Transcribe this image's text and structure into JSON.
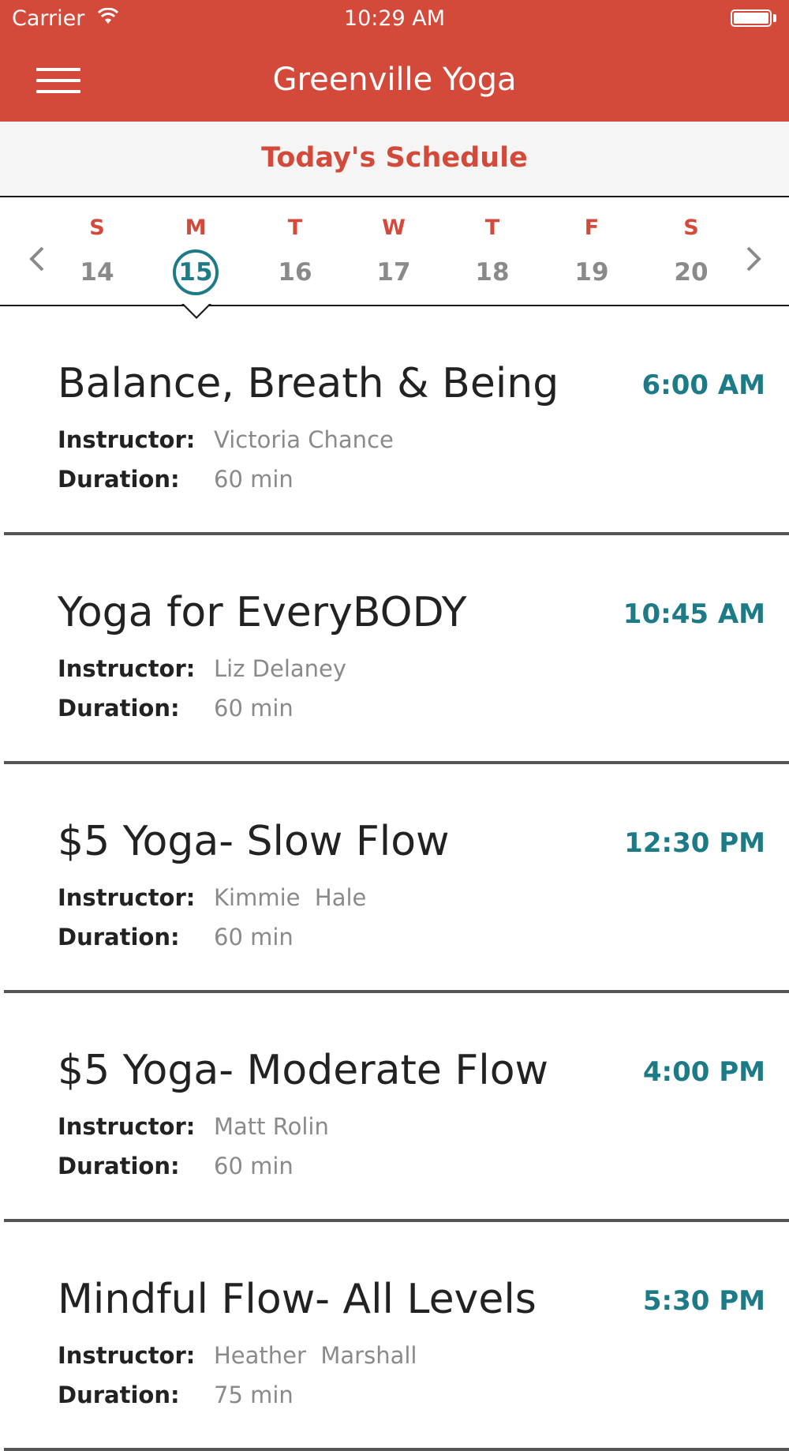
{
  "status_bar": {
    "carrier": "Carrier",
    "time": "10:29 AM"
  },
  "nav": {
    "title": "Greenville Yoga",
    "menu_icon": "hamburger-menu-icon"
  },
  "schedule_header": {
    "title": "Today's Schedule"
  },
  "week": {
    "days": [
      {
        "letter": "S",
        "number": "14"
      },
      {
        "letter": "M",
        "number": "15",
        "selected": true
      },
      {
        "letter": "T",
        "number": "16"
      },
      {
        "letter": "W",
        "number": "17"
      },
      {
        "letter": "T",
        "number": "18"
      },
      {
        "letter": "F",
        "number": "19"
      },
      {
        "letter": "S",
        "number": "20"
      }
    ]
  },
  "labels": {
    "instructor": "Instructor:",
    "duration": "Duration:"
  },
  "classes": [
    {
      "title": "Balance, Breath & Being",
      "time": "6:00 AM",
      "instructor": "Victoria Chance",
      "duration": "60 min"
    },
    {
      "title": "Yoga for EveryBODY",
      "time": "10:45 AM",
      "instructor": "Liz Delaney",
      "duration": "60 min"
    },
    {
      "title": "$5 Yoga- Slow Flow",
      "time": "12:30 PM",
      "instructor": "Kimmie  Hale",
      "duration": "60 min"
    },
    {
      "title": "$5 Yoga- Moderate Flow",
      "time": "4:00 PM",
      "instructor": "Matt Rolin",
      "duration": "60 min"
    },
    {
      "title": "Mindful Flow- All Levels",
      "time": "5:30 PM",
      "instructor": "Heather  Marshall",
      "duration": "75 min"
    }
  ],
  "colors": {
    "brand_red": "#d44a3a",
    "accent_teal": "#1d7a87"
  }
}
